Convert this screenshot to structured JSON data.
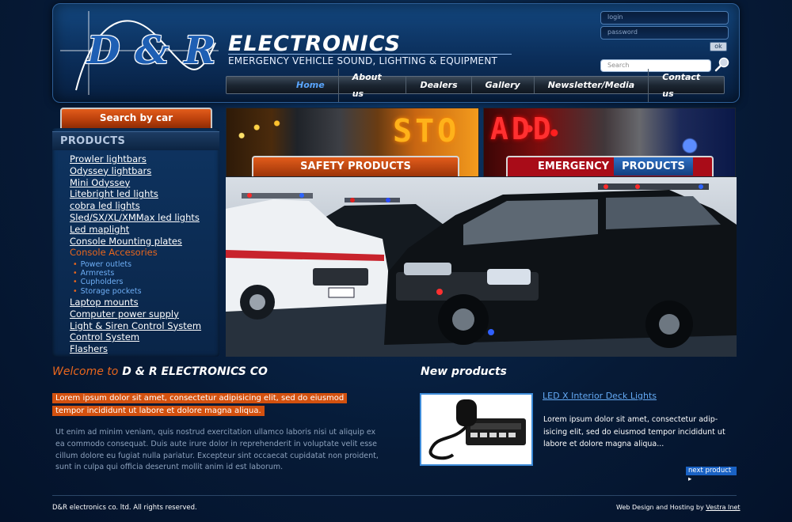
{
  "header": {
    "logo_text": "D & R",
    "title": "ELECTRONICS",
    "subtitle": "EMERGENCY VEHICLE SOUND, LIGHTING & EQUIPMENT",
    "login_placeholder": "login",
    "password_placeholder": "password",
    "ok_label": "ok",
    "search_placeholder": "Search"
  },
  "nav": {
    "items": [
      "Home",
      "About us",
      "Dealers",
      "Gallery",
      "Newsletter/Media",
      "Contact us"
    ],
    "active": "Home"
  },
  "sidebar": {
    "search_button": "Search by car",
    "products_title": "PRODUCTS",
    "items": [
      "Prowler lightbars",
      "Odyssey lightbars",
      "Mini Odyssey",
      "Litebright led lights",
      "cobra led lights",
      "Sled/SX/XL/XMMax led lights",
      "Led maplight",
      "Console Mounting plates",
      "Console Accesories"
    ],
    "subitems": [
      "Power outlets",
      "Armrests",
      "Cupholders",
      "Storage pockets"
    ],
    "items_after": [
      "Laptop mounts",
      "Computer power supply",
      "Light & Siren Control System",
      "Control System",
      "Flashers"
    ]
  },
  "banners": {
    "safety_label": "SAFETY PRODUCTS",
    "safety_led": "STO",
    "emergency_label_a": "EMERGENCY",
    "emergency_label_b": "PRODUCTS",
    "emergency_led": "ADD"
  },
  "welcome": {
    "title_accent": "Welcome to",
    "title_main": "D & R ELECTRONICS CO",
    "highlight": "Lorem ipsum dolor sit amet, consectetur adipisicing elit, sed do eiusmod tempor incididunt ut labore et dolore magna aliqua.",
    "body": "Ut enim ad minim veniam, quis nostrud exercitation ullamco laboris nisi ut aliquip ex ea commodo consequat. Duis aute irure dolor in reprehenderit in voluptate velit esse cillum dolore eu fugiat nulla pariatur. Excepteur sint occaecat cupidatat non proident, sunt in culpa qui officia deserunt mollit anim id est laborum."
  },
  "new_products": {
    "title": "New products",
    "product_name": "LED X Interior Deck Lights",
    "product_desc": "Lorem ipsum dolor sit amet, consectetur adip-isicing elit, sed do eiusmod tempor incididunt ut labore et dolore magna aliqua...",
    "next_label": "next product"
  },
  "footer": {
    "copyright": "D&R electronics co. ltd. All rights reserved.",
    "credit_prefix": "Web Design and Hosting by",
    "credit_link": "Vestra Inet"
  },
  "colors": {
    "accent_orange": "#e8661d",
    "link_blue": "#64aaf5",
    "background_navy": "#061a36"
  }
}
